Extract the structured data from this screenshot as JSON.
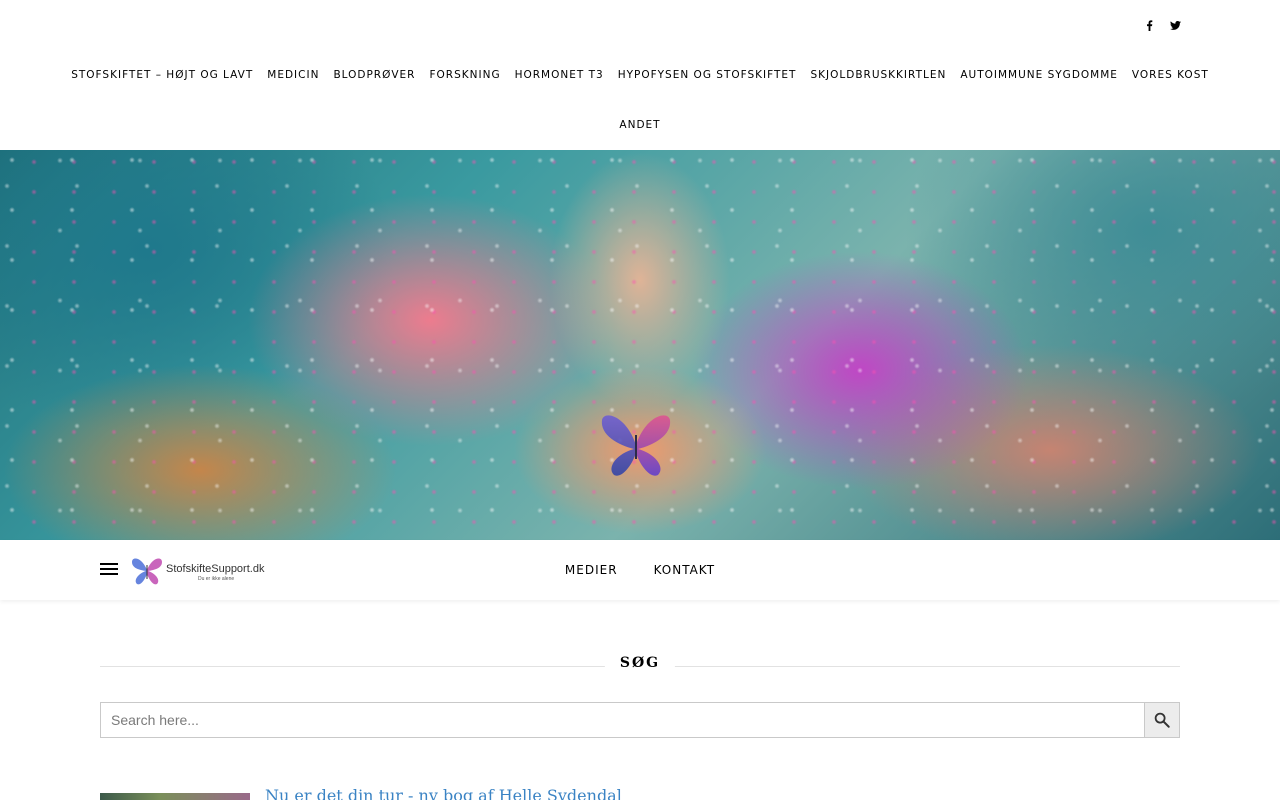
{
  "social": {
    "facebook_label": "f",
    "twitter_label": "t"
  },
  "nav": {
    "row1": [
      "STOFSKIFTET – HØJT OG LAVT",
      "MEDICIN",
      "BLODPRØVER",
      "FORSKNING",
      "HORMONET T3",
      "HYPOFYSEN OG STOFSKIFTET",
      "SKJOLDBRUSKKIRTLEN",
      "AUTOIMMUNE SYGDOMME",
      "VORES KOST"
    ],
    "row2": [
      "ANDET"
    ]
  },
  "logo": {
    "text": "StofskifteSupport.dk",
    "tagline": "Du er ikke alene"
  },
  "sub_nav": [
    "MEDIER",
    "KONTAKT"
  ],
  "search": {
    "title": "SØG",
    "placeholder": "Search here..."
  },
  "post": {
    "title": "Nu er det din tur - ny bog af Helle Sydendal"
  }
}
